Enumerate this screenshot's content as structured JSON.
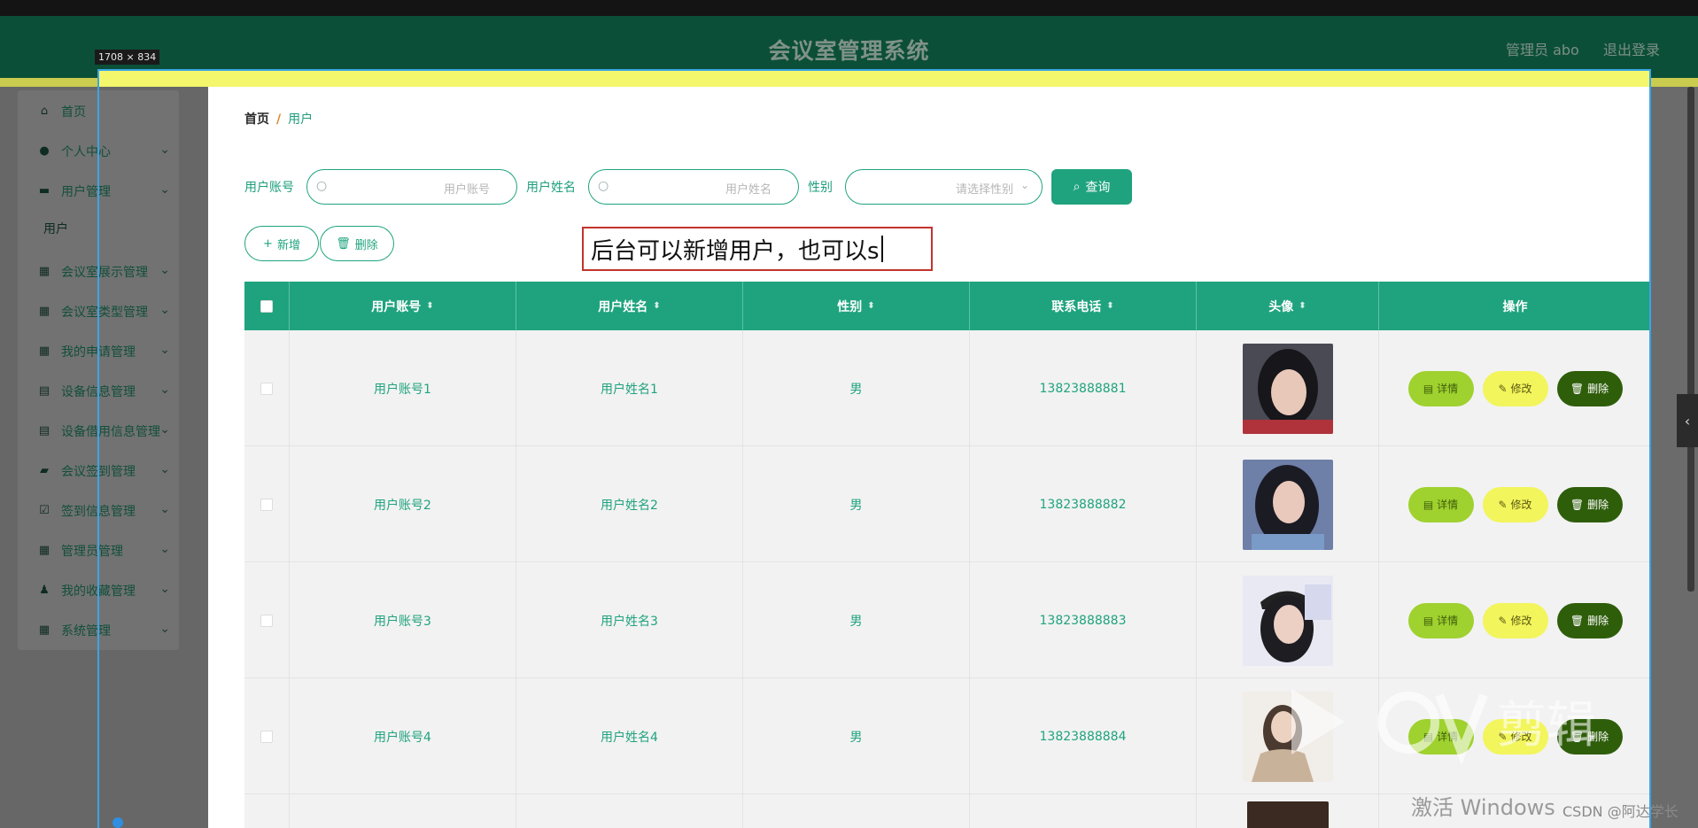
{
  "window": {
    "dimension_label": "1708 × 834"
  },
  "header": {
    "title": "会议室管理系统",
    "admin": "管理员 abo",
    "logout": "退出登录"
  },
  "sidebar": {
    "items": [
      {
        "label": "首页",
        "icon": "home-icon"
      },
      {
        "label": "个人中心",
        "icon": "user-icon"
      },
      {
        "label": "用户管理",
        "icon": "briefcase-icon"
      },
      {
        "label": "会议室展示管理",
        "icon": "grid-icon"
      },
      {
        "label": "会议室类型管理",
        "icon": "grid-icon"
      },
      {
        "label": "我的申请管理",
        "icon": "grid-icon"
      },
      {
        "label": "设备信息管理",
        "icon": "clipboard-icon"
      },
      {
        "label": "设备借用信息管理",
        "icon": "clipboard-icon"
      },
      {
        "label": "会议签到管理",
        "icon": "wallet-icon"
      },
      {
        "label": "签到信息管理",
        "icon": "checklist-icon"
      },
      {
        "label": "管理员管理",
        "icon": "apps-icon"
      },
      {
        "label": "我的收藏管理",
        "icon": "person-icon"
      },
      {
        "label": "系统管理",
        "icon": "grid-icon"
      }
    ],
    "sub_item": "用户"
  },
  "breadcrumb": {
    "home": "首页",
    "separator": "/",
    "current": "用户"
  },
  "filters": {
    "account_label": "用户账号",
    "account_placeholder": "用户账号",
    "name_label": "用户姓名",
    "name_placeholder": "用户姓名",
    "gender_label": "性别",
    "gender_placeholder": "请选择性别",
    "search_button": "查询"
  },
  "actions": {
    "add": "新增",
    "delete": "删除"
  },
  "annotation": {
    "text": "后台可以新增用户，也可以s"
  },
  "table": {
    "headers": [
      "用户账号",
      "用户姓名",
      "性别",
      "联系电话",
      "头像",
      "操作"
    ],
    "rows": [
      {
        "account": "用户账号1",
        "name": "用户姓名1",
        "gender": "男",
        "phone": "13823888881"
      },
      {
        "account": "用户账号2",
        "name": "用户姓名2",
        "gender": "男",
        "phone": "13823888882"
      },
      {
        "account": "用户账号3",
        "name": "用户姓名3",
        "gender": "男",
        "phone": "13823888883"
      },
      {
        "account": "用户账号4",
        "name": "用户姓名4",
        "gender": "男",
        "phone": "13823888884"
      }
    ],
    "row_actions": {
      "detail": "详情",
      "edit": "修改",
      "delete": "删除"
    }
  },
  "watermarks": {
    "ev": "剪辑",
    "windows": "激活 Windows",
    "csdn": "CSDN @阿达学长"
  },
  "colors": {
    "primary": "#1fa37e",
    "header_bg": "#0c4f38",
    "detail_btn": "#9fd12f",
    "edit_btn": "#f2f55c",
    "delete_btn": "#2f5e0b"
  }
}
